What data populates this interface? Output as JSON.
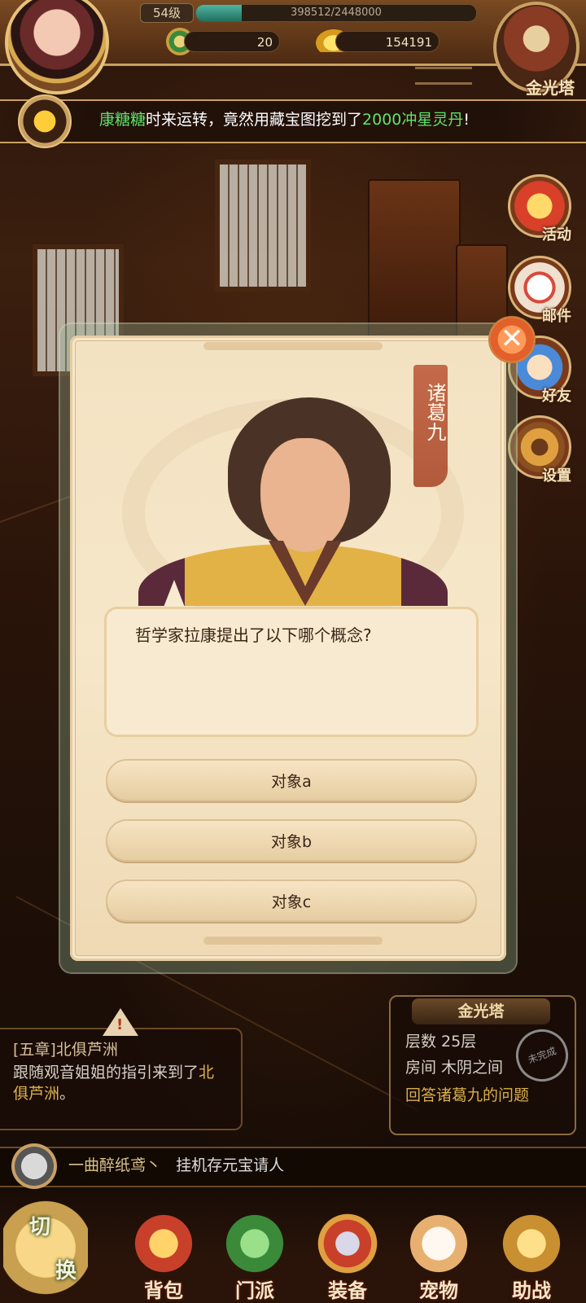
{
  "header": {
    "level": "54级",
    "exp_text": "398512/2448000",
    "exp_fraction": 0.163,
    "jade_count": "20",
    "gold_count": "154191",
    "tower_label": "金光塔"
  },
  "announcement": {
    "player": "康糖糖",
    "middle": "时来运转，竟然用藏宝图挖到了",
    "reward": "2000冲星灵丹",
    "end": "!"
  },
  "side_menu": {
    "activity": "活动",
    "mail": "邮件",
    "friends": "好友",
    "settings": "设置"
  },
  "dialog": {
    "npc_name": "诸葛九",
    "question": "哲学家拉康提出了以下哪个概念?",
    "answers": [
      "对象a",
      "对象b",
      "对象c"
    ]
  },
  "quest": {
    "title": "[五章]北俱芦洲",
    "desc_prefix": "跟随观音姐姐的指引来到了",
    "desc_highlight1": "北",
    "desc_highlight2": "俱芦洲",
    "desc_suffix": "。"
  },
  "tower_panel": {
    "title": "金光塔",
    "floor": "层数 25层",
    "room": "房间 木阴之间",
    "task": "回答诸葛九的问题",
    "stamp": "未完成"
  },
  "chat": {
    "name": "一曲醉纸鸢丶",
    "message": "挂机存元宝请人"
  },
  "bottom_nav": {
    "switch_top": "切",
    "switch_bottom": "换",
    "items": [
      "背包",
      "门派",
      "装备",
      "宠物",
      "助战"
    ]
  }
}
